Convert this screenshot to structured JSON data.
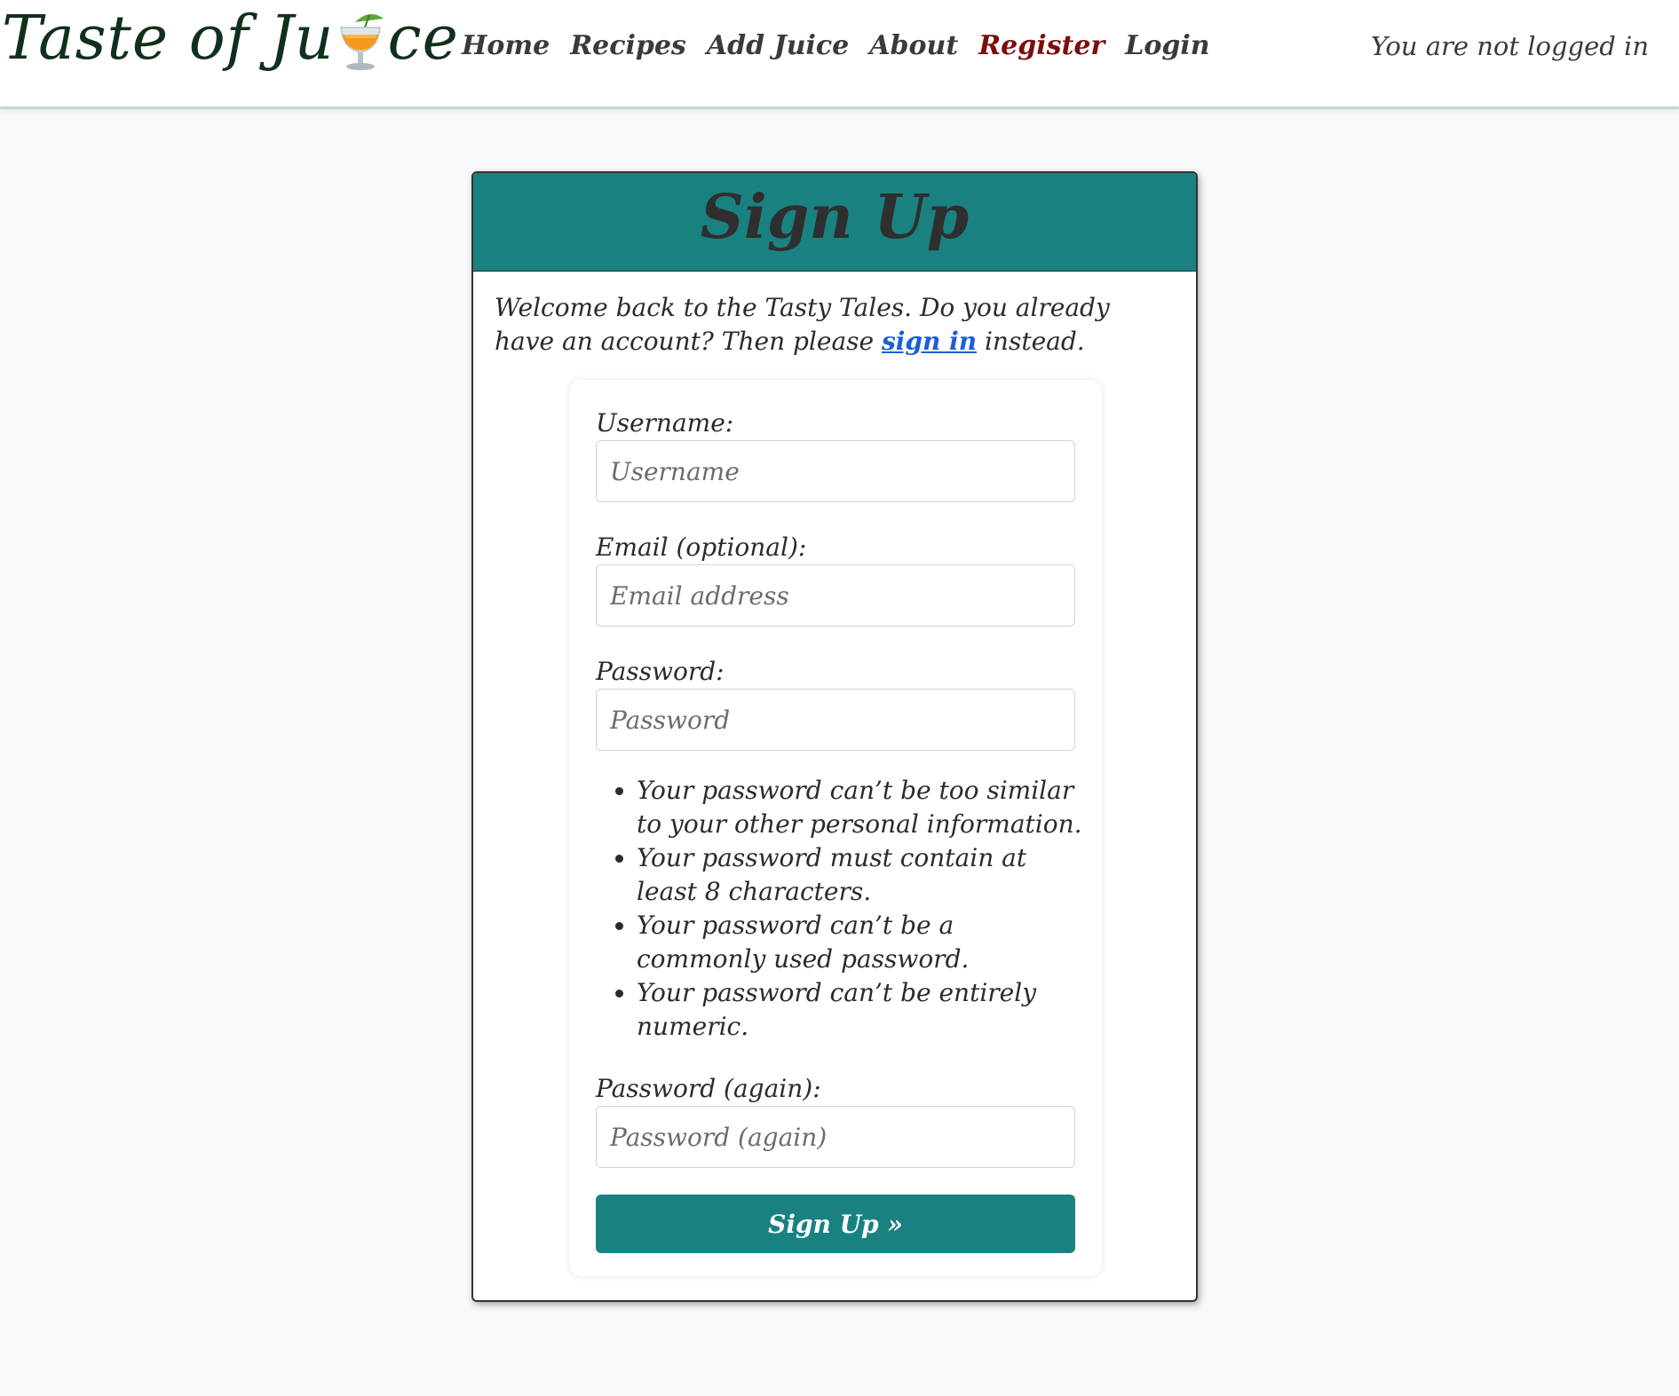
{
  "navbar": {
    "brand_start": "Taste of Ju",
    "brand_end": "ce",
    "brand_icon": "tropical-drink-icon",
    "links": [
      {
        "label": "Home",
        "active": false
      },
      {
        "label": "Recipes",
        "active": false
      },
      {
        "label": "Add Juice",
        "active": false
      },
      {
        "label": "About",
        "active": false
      },
      {
        "label": "Register",
        "active": true
      },
      {
        "label": "Login",
        "active": false
      }
    ],
    "status_text": "You are not logged in"
  },
  "signup": {
    "title": "Sign Up",
    "intro_before": "Welcome back to the Tasty Tales. Do you already have an account? Then please ",
    "intro_link": "sign in",
    "intro_after": " instead.",
    "fields": {
      "username": {
        "label": "Username:",
        "placeholder": "Username",
        "value": ""
      },
      "email": {
        "label": "Email (optional):",
        "placeholder": "Email address",
        "value": ""
      },
      "password": {
        "label": "Password:",
        "placeholder": "Password",
        "value": ""
      },
      "password2": {
        "label": "Password (again):",
        "placeholder": "Password (again)",
        "value": ""
      }
    },
    "password_help": [
      "Your password can’t be too similar to your other personal information.",
      "Your password must contain at least 8 characters.",
      "Your password can’t be a commonly used password.",
      "Your password can’t be entirely numeric."
    ],
    "submit_label": "Sign Up »"
  },
  "colors": {
    "accent": "#198281",
    "active_link": "#7a0d0d",
    "link": "#1a5fd6",
    "background": "#f8f9fa"
  }
}
